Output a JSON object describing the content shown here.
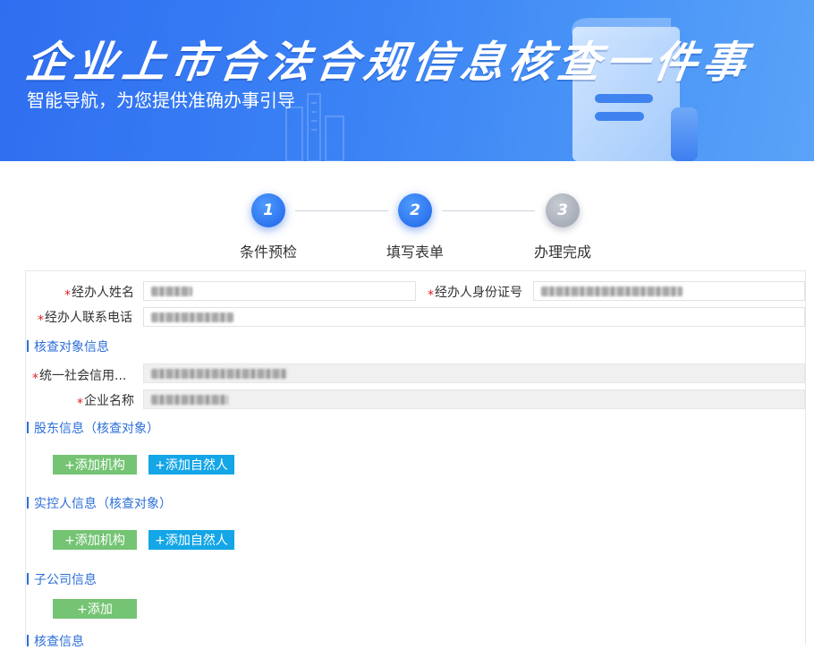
{
  "banner": {
    "title": "企业上市合法合规信息核查一件事",
    "subtitle": "智能导航，为您提供准确办事引导"
  },
  "steps": [
    {
      "number": "1",
      "label": "条件预检",
      "state": "done"
    },
    {
      "number": "2",
      "label": "填写表单",
      "state": "current"
    },
    {
      "number": "3",
      "label": "办理完成",
      "state": "pending"
    }
  ],
  "form": {
    "required_mark": "*",
    "agent_name_label": "经办人姓名",
    "agent_id_label": "经办人身份证号",
    "agent_phone_label": "经办人联系电话",
    "target_section": "核查对象信息",
    "credit_code_label": "统一社会信用...",
    "company_name_label": "企业名称",
    "shareholder_section": "股东信息（核查对象）",
    "controller_section": "实控人信息（核查对象）",
    "subsidiary_section": "子公司信息",
    "check_section": "核查信息",
    "add_org_label": "+添加机构",
    "add_person_label": "+添加自然人",
    "add_label": "+添加"
  },
  "colors": {
    "banner_start": "#2f6ef0",
    "banner_end": "#5aa3f8",
    "step_active": "#1e63e6",
    "step_inactive": "#9aa1ad",
    "section_title": "#2d6fd8",
    "required": "#e02020",
    "btn_green": "#74c474",
    "btn_blue": "#14a6e6"
  }
}
